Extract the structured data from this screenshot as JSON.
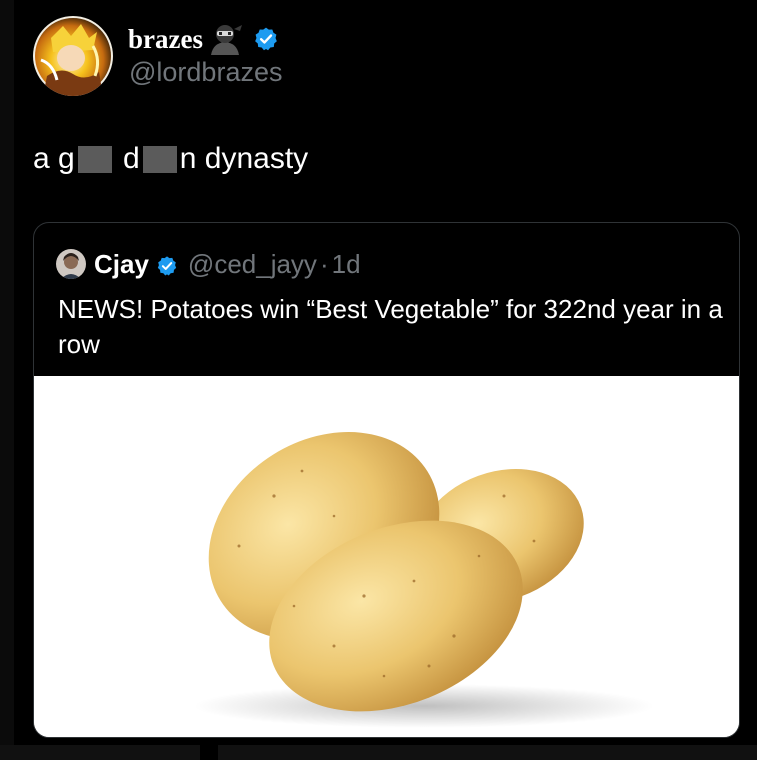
{
  "post": {
    "author_name": "brazes",
    "author_handle": "@lordbrazes",
    "text_parts": [
      "a g",
      " d",
      "n dynasty"
    ]
  },
  "quote": {
    "author_name": "Cjay",
    "author_handle": "@ced_jayy",
    "separator": "·",
    "time": "1d",
    "text": "NEWS! Potatoes win “Best Vegetable” for 322nd year in a row"
  },
  "icons": {
    "verified": "verified-badge-icon",
    "ninja": "ninja-emoji-icon",
    "verified_color": "#1d9bf0"
  },
  "media": {
    "subject": "three potatoes on white background",
    "background_color": "#ffffff"
  }
}
